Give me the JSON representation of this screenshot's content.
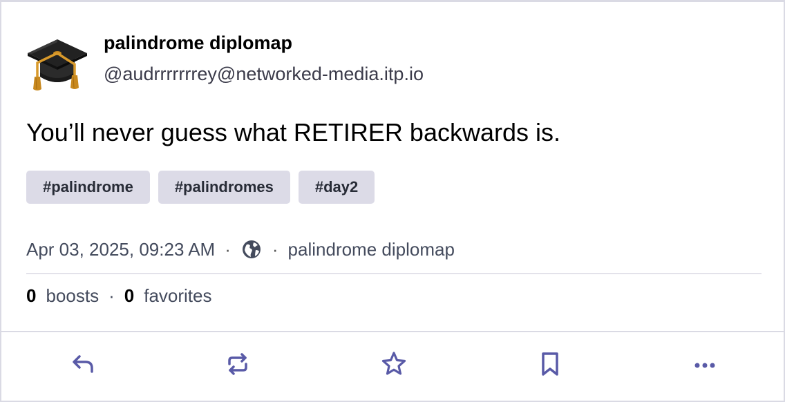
{
  "post": {
    "author": {
      "display_name": "palindrome diplomap",
      "handle": "@audrrrrrrrey@networked-media.itp.io",
      "avatar_icon": "graduation-cap"
    },
    "content": "You’ll never guess what RETIRER backwards is.",
    "tags": [
      "#palindrome",
      "#palindromes",
      "#day2"
    ],
    "timestamp": "Apr 03, 2025, 09:23 AM",
    "visibility_icon": "globe",
    "application": "palindrome diplomap",
    "boosts_count": "0",
    "boosts_label": "boosts",
    "favorites_count": "0",
    "favorites_label": "favorites"
  },
  "actions": {
    "reply": "reply-icon",
    "boost": "boost-icon",
    "favorite": "star-icon",
    "bookmark": "bookmark-icon",
    "more": "more-icon"
  },
  "colors": {
    "tag_bg": "#dcdbe7",
    "action_icon": "#595aa7",
    "border": "#dadae4"
  }
}
